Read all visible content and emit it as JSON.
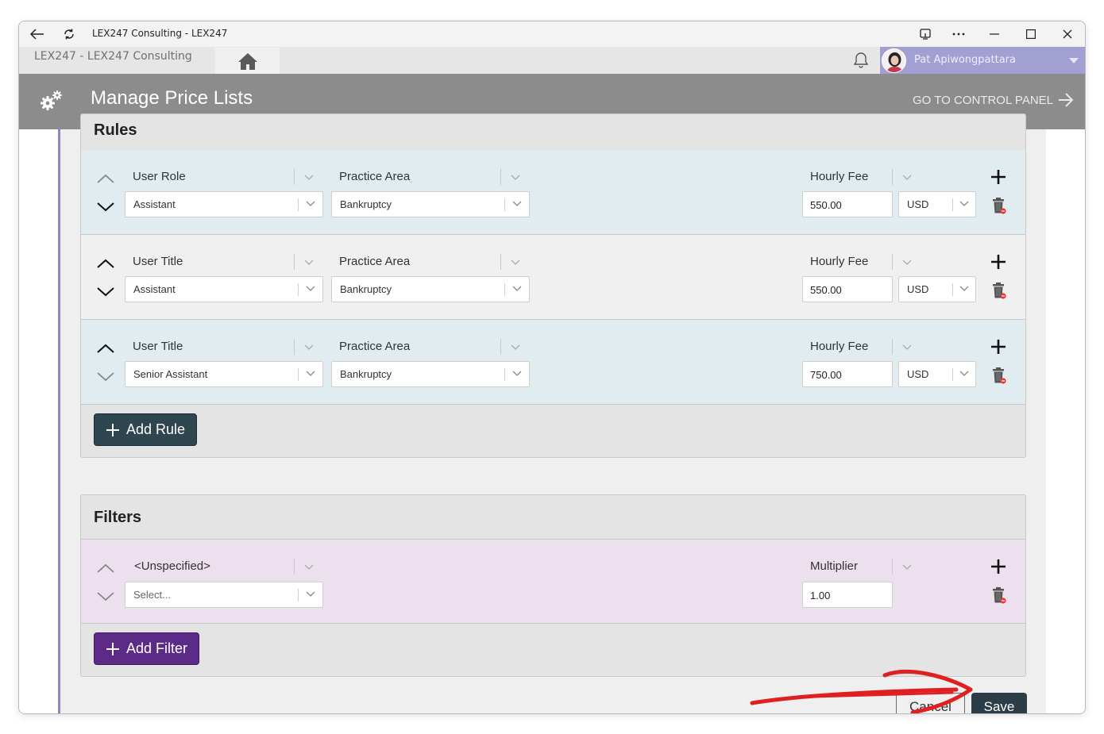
{
  "window": {
    "title": "LEX247 Consulting - LEX247"
  },
  "subbar": {
    "breadcrumb": "LEX247  -  LEX247 Consulting",
    "user_name": "Pat Apiwongpattara"
  },
  "header": {
    "title": "Manage Price Lists",
    "control_panel_link": "GO TO CONTROL PANEL"
  },
  "rules": {
    "title": "Rules",
    "rows": [
      {
        "type_label": "User Role",
        "type_value": "Assistant",
        "area_label": "Practice Area",
        "area_value": "Bankruptcy",
        "fee_label": "Hourly Fee",
        "fee_value": "550.00",
        "currency": "USD"
      },
      {
        "type_label": "User Title",
        "type_value": "Assistant",
        "area_label": "Practice Area",
        "area_value": "Bankruptcy",
        "fee_label": "Hourly Fee",
        "fee_value": "550.00",
        "currency": "USD"
      },
      {
        "type_label": "User Title",
        "type_value": "Senior Assistant",
        "area_label": "Practice Area",
        "area_value": "Bankruptcy",
        "fee_label": "Hourly Fee",
        "fee_value": "750.00",
        "currency": "USD"
      }
    ],
    "add_label": "Add Rule"
  },
  "filters": {
    "title": "Filters",
    "rows": [
      {
        "type_label": "<Unspecified>",
        "type_placeholder": "Select...",
        "mult_label": "Multiplier",
        "mult_value": "1.00"
      }
    ],
    "add_label": "Add Filter"
  },
  "footer": {
    "cancel_label": "Cancel",
    "save_label": "Save"
  },
  "colors": {
    "header_bg": "#8c8c8c",
    "user_box": "#a29fd2",
    "add_rule_btn": "#2f4550",
    "add_filter_btn": "#5c2b87",
    "save_btn": "#2b3e48",
    "annotation_red": "#e02020"
  },
  "icons": [
    "back-arrow-icon",
    "refresh-icon",
    "cast-icon",
    "more-icon",
    "minimize-icon",
    "maximize-icon",
    "close-icon",
    "home-icon",
    "bell-icon",
    "gears-icon",
    "arrow-right-icon",
    "chevron-up-icon",
    "chevron-down-icon",
    "plus-icon",
    "trash-icon"
  ]
}
